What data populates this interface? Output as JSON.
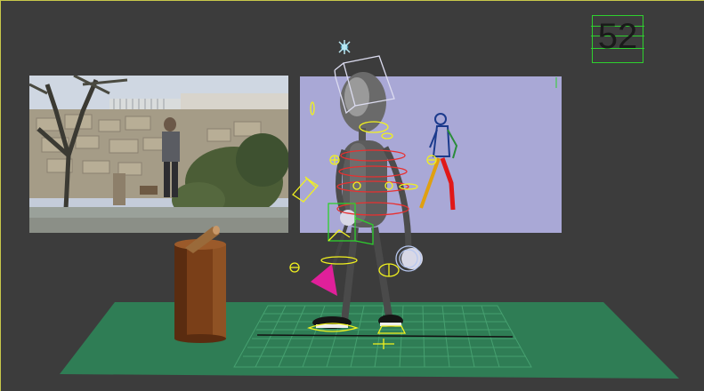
{
  "viewport": {
    "frame_counter": "52",
    "colors": {
      "background": "#3c3c3c",
      "viewport_border": "#c8c84a",
      "ground_plane": "#2f7d55",
      "grid_lines": "#3f9a6a",
      "reference_panel": "#a9a8d6",
      "selection_box": "#2ed02e",
      "gizmo_yellow": "#f2f21e",
      "stump": "#7a3f18",
      "character": "#5a5a5a",
      "axe_head": "#e0209a"
    },
    "icons": [
      "light-gizmo-icon",
      "selection-bracket-icon"
    ]
  }
}
